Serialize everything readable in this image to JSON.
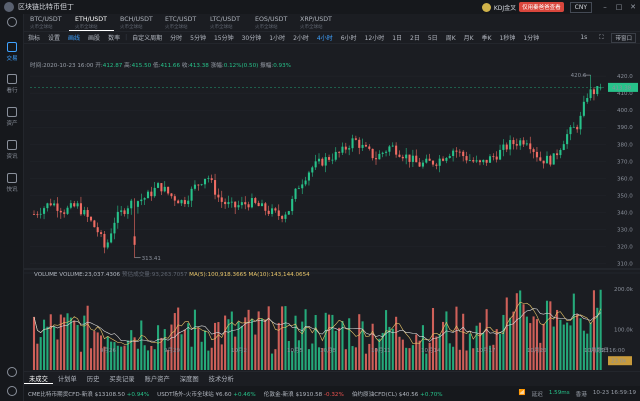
{
  "app": {
    "title": "区块链比特币但丁",
    "username": "KDJ金叉",
    "vip_label": "仅用秦爸爸查看",
    "currency": "CNY"
  },
  "sidebar": {
    "items": [
      {
        "label": "交易",
        "icon": "exchange-icon"
      },
      {
        "label": "看行",
        "icon": "market-icon"
      },
      {
        "label": "资产",
        "icon": "asset-icon"
      },
      {
        "label": "资讯",
        "icon": "news-icon"
      },
      {
        "label": "快讯",
        "icon": "flash-icon"
      }
    ]
  },
  "market_tabs": [
    {
      "pair": "BTC/USDT",
      "sub": "火币全球站"
    },
    {
      "pair": "ETH/USDT",
      "sub": "火币全球站"
    },
    {
      "pair": "BCH/USDT",
      "sub": "火币全球站"
    },
    {
      "pair": "ETC/USDT",
      "sub": "火币全球站"
    },
    {
      "pair": "LTC/USDT",
      "sub": "火币全球站"
    },
    {
      "pair": "EOS/USDT",
      "sub": "火币全球站"
    },
    {
      "pair": "XRP/USDT",
      "sub": "火币全球站"
    }
  ],
  "toolbar": {
    "items": [
      "指标",
      "设置",
      "画线",
      "画股",
      "数率"
    ],
    "custom": "自定义周期",
    "periods": [
      "分时",
      "5分钟",
      "15分钟",
      "30分钟",
      "1小时",
      "2小时",
      "4小时",
      "6小时",
      "12小时",
      "1日",
      "2日",
      "5日",
      "周K",
      "月K",
      "季K",
      "1秒钟",
      "1分钟"
    ],
    "fullscreen": "1s",
    "layout": "带窗口"
  },
  "ohlc": {
    "time_label": "时间:",
    "time": "2020-10-23 16:00",
    "open_label": "开:",
    "open": "412.87",
    "high_label": "高:",
    "high": "415.50",
    "low_label": "低:",
    "low": "411.66",
    "close_label": "收:",
    "close": "413.38",
    "change_label": "涨幅:",
    "change": "0.12%(0.50)",
    "amp_label": "振幅:",
    "amp": "0.93%"
  },
  "volume_header": {
    "label": "VOLUME",
    "volume": "VOLUME:23,037.4306",
    "dim": "预估成交量:93,263.7057",
    "ma5": "MA(5):100,918.3665",
    "ma10": "MA(10):143,144.0654"
  },
  "chart_data": {
    "type": "candlestick",
    "y_ticks": [
      "420.0",
      "410.0",
      "400.0",
      "390.0",
      "380.0",
      "370.0",
      "360.0",
      "350.0",
      "340.0",
      "330.0",
      "320.0",
      "310.0"
    ],
    "ylim": [
      308,
      423
    ],
    "x_ticks": [
      "9月26",
      "9月29",
      "10月2",
      "10月5",
      "10月8",
      "10月11",
      "10月14",
      "10月17",
      "10月20",
      "10月23"
    ],
    "last_price": "413.38",
    "high_label": "420.6",
    "low_label": "313.41",
    "volume_last": "23.0k",
    "vol_ticks": [
      "200.0k",
      "100.0k"
    ],
    "last_x_label": "10月23日16:00"
  },
  "bottom_tabs": [
    "未成交",
    "计划单",
    "历史",
    "买卖记录",
    "账户资产",
    "深度图",
    "技术分析"
  ],
  "status": {
    "tickers": [
      {
        "name": "CME比特币期货CFD-新浪",
        "price": "$13108.50",
        "chg": "+0.94%",
        "dir": "up"
      },
      {
        "name": "USDT场外-火币全球站",
        "price": "¥6.60",
        "chg": "+0.46%",
        "dir": "up"
      },
      {
        "name": "伦敦金-新浪",
        "price": "$1910.58",
        "chg": "-0.32%",
        "dir": "dn"
      },
      {
        "name": "伯约原油CFD(CL)",
        "price": "$40.56",
        "chg": "+0.70%",
        "dir": "up"
      }
    ],
    "latency_label": "延迟",
    "latency": "1.59ms",
    "region": "香港",
    "datetime": "10-23 16:59:19"
  }
}
